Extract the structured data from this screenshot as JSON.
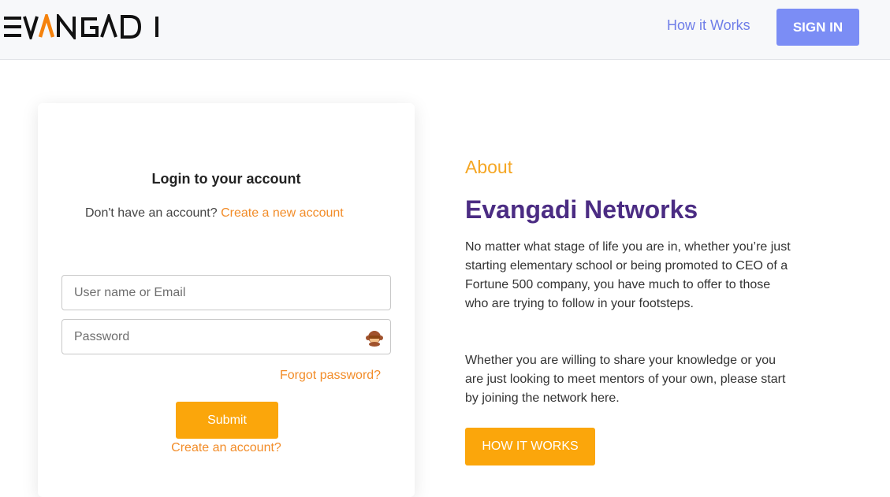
{
  "header": {
    "logo_text": "EVANGADI",
    "nav_how_it_works": "How it Works",
    "sign_in": "SIGN IN"
  },
  "login": {
    "title": "Login to your account",
    "no_account_text": "Don't have an account? ",
    "create_new_account": "Create a new account",
    "username_placeholder": "User name or Email",
    "password_placeholder": "Password",
    "forgot_password": "Forgot password?",
    "submit": "Submit",
    "create_account": "Create an account?"
  },
  "about": {
    "label": "About",
    "title": "Evangadi Networks",
    "paragraph1": "No matter what stage of life you are in, whether you’re just starting elementary school or being promoted to CEO of a Fortune 500 company, you have much to offer to those who are trying to follow in your footsteps.",
    "paragraph2": "Whether you are willing to share your knowledge or you are just looking to meet mentors of your own, please start by joining the network here.",
    "how_it_works_button": "HOW IT WORKS"
  },
  "colors": {
    "accent_orange": "#fba60b",
    "link_orange": "#f28c28",
    "brand_purple": "#4b2c83",
    "nav_blue": "#6f7ee8",
    "sign_in_bg": "#7b8df5"
  },
  "icons": {
    "password_toggle": "monkey-eye-icon"
  }
}
